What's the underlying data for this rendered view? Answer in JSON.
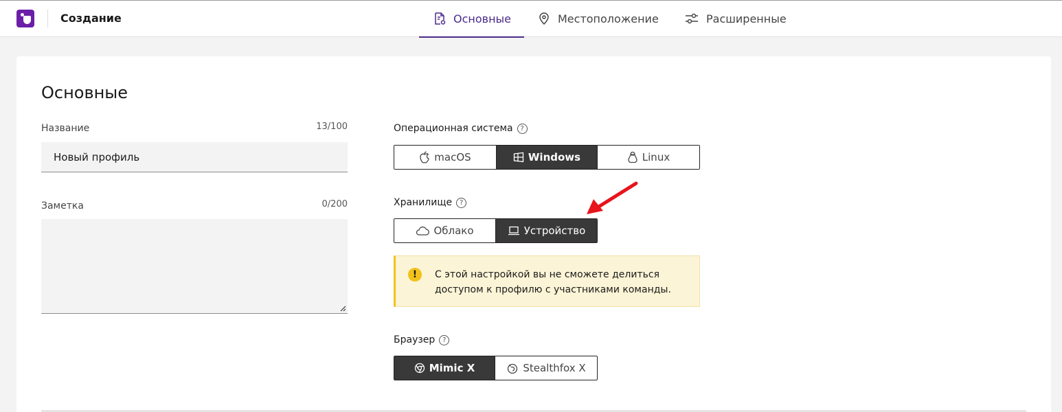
{
  "header": {
    "title": "Создание",
    "tabs": [
      {
        "label": "Основные",
        "icon": "document-settings-icon",
        "active": true
      },
      {
        "label": "Местоположение",
        "icon": "location-pin-icon",
        "active": false
      },
      {
        "label": "Расширенные",
        "icon": "sliders-icon",
        "active": false
      }
    ]
  },
  "main": {
    "section_title": "Основные",
    "name_field": {
      "label": "Название",
      "counter": "13/100",
      "value": "Новый профиль"
    },
    "note_field": {
      "label": "Заметка",
      "counter": "0/200",
      "value": ""
    },
    "os": {
      "label": "Операционная система",
      "options": [
        "macOS",
        "Windows",
        "Linux"
      ],
      "selected": "Windows"
    },
    "storage": {
      "label": "Хранилище",
      "options": [
        "Облако",
        "Устройство"
      ],
      "selected": "Устройство"
    },
    "notice": {
      "text": "С этой настройкой вы не сможете делиться доступом к профилю с участниками команды."
    },
    "browser": {
      "label": "Браузер",
      "options": [
        "Mimic X",
        "Stealthfox X"
      ],
      "selected": "Mimic X"
    },
    "help_glyph": "?",
    "warning_glyph": "!"
  },
  "colors": {
    "accent": "#4a2a8a",
    "logo": "#6b1fa8",
    "selected_bg": "#393939",
    "warning": "#f1c21b",
    "annotation_arrow": "#e8141c"
  }
}
